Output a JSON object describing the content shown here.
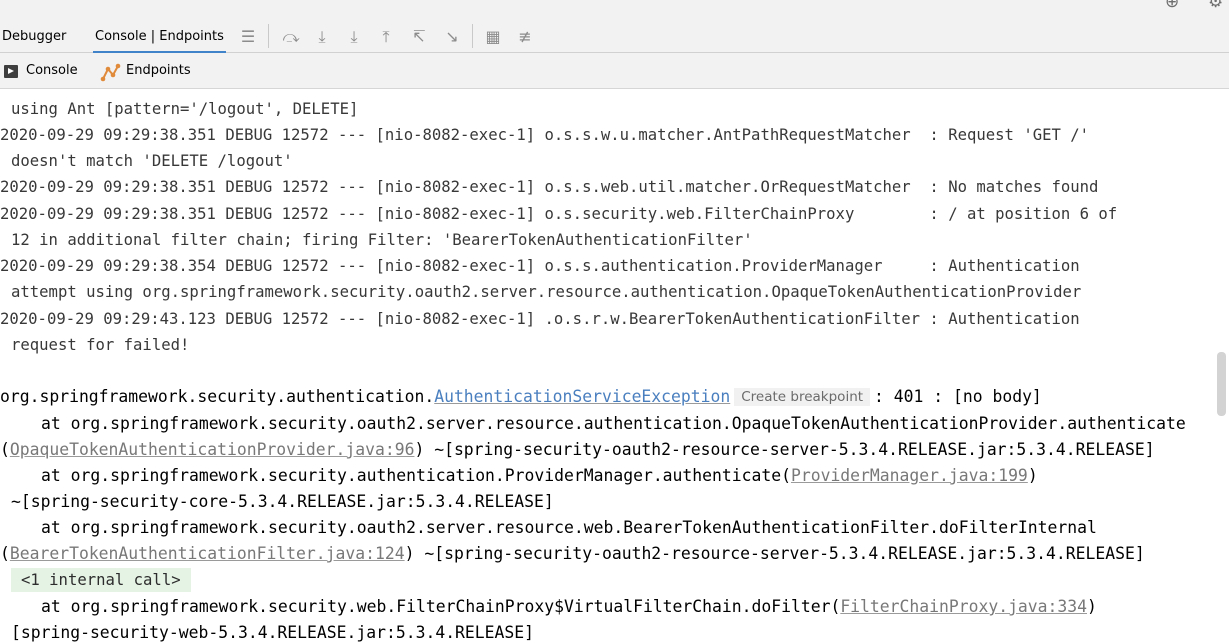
{
  "toolbar": {
    "tabs": [
      {
        "label": "Debugger",
        "active": false
      },
      {
        "label": "Console | Endpoints",
        "active": true
      }
    ],
    "icons": [
      "menu-icon",
      "show-execution-point-icon",
      "step-over-icon",
      "step-into-icon",
      "step-out-icon",
      "run-to-cursor-icon",
      "evaluate-expression-icon",
      "table-view-icon",
      "trace-settings-icon"
    ]
  },
  "subtabs": [
    {
      "label": "Console",
      "icon": "console-icon"
    },
    {
      "label": "Endpoints",
      "icon": "endpoints-icon"
    }
  ],
  "console": {
    "lines": [
      {
        "text": "using Ant [pattern='/logout', DELETE]",
        "indent": true
      },
      {
        "text": "2020-09-29 09:29:38.351 DEBUG 12572 --- [nio-8082-exec-1] o.s.s.w.u.matcher.AntPathRequestMatcher  : Request 'GET /'"
      },
      {
        "text": "doesn't match 'DELETE /logout'",
        "indent": true
      },
      {
        "text": "2020-09-29 09:29:38.351 DEBUG 12572 --- [nio-8082-exec-1] o.s.s.web.util.matcher.OrRequestMatcher  : No matches found"
      },
      {
        "text": "2020-09-29 09:29:38.351 DEBUG 12572 --- [nio-8082-exec-1] o.s.security.web.FilterChainProxy        : / at position 6 of"
      },
      {
        "text": "12 in additional filter chain; firing Filter: 'BearerTokenAuthenticationFilter'",
        "indent": true
      },
      {
        "text": "2020-09-29 09:29:38.354 DEBUG 12572 --- [nio-8082-exec-1] o.s.s.authentication.ProviderManager     : Authentication"
      },
      {
        "text": "attempt using org.springframework.security.oauth2.server.resource.authentication.OpaqueTokenAuthenticationProvider",
        "indent": true
      },
      {
        "text": "2020-09-29 09:29:43.123 DEBUG 12572 --- [nio-8082-exec-1] .o.s.r.w.BearerTokenAuthenticationFilter : Authentication"
      },
      {
        "text": "request for failed!",
        "indent": true
      }
    ],
    "exception": {
      "prefix": "org.springframework.security.authentication.",
      "class_name": "AuthenticationServiceException",
      "breakpoint_label": "Create breakpoint",
      "message": ": 401 : [no body]"
    },
    "trace1": {
      "at": "at org.springframework.security.oauth2.server.resource.authentication.OpaqueTokenAuthenticationProvider.authenticate",
      "open": "(",
      "link": "OpaqueTokenAuthenticationProvider.java:96",
      "tail": ") ~[spring-security-oauth2-resource-server-5.3.4.RELEASE.jar:5.3.4.RELEASE]"
    },
    "trace2": {
      "at": "at org.springframework.security.authentication.ProviderManager.authenticate(",
      "link": "ProviderManager.java:199",
      "close": ")",
      "jar": "~[spring-security-core-5.3.4.RELEASE.jar:5.3.4.RELEASE]"
    },
    "trace3": {
      "at": "at org.springframework.security.oauth2.server.resource.web.BearerTokenAuthenticationFilter.doFilterInternal",
      "open": "(",
      "link": "BearerTokenAuthenticationFilter.java:124",
      "tail": ") ~[spring-security-oauth2-resource-server-5.3.4.RELEASE.jar:5.3.4.RELEASE]"
    },
    "internal_call": "<1 internal call>",
    "trace4": {
      "at": "at org.springframework.security.web.FilterChainProxy$VirtualFilterChain.doFilter(",
      "link": "FilterChainProxy.java:334",
      "close": ")",
      "jar": "[spring-security-web-5.3.4.RELEASE.jar:5.3.4.RELEASE]"
    }
  },
  "colors": {
    "link": "#787878",
    "exception_class": "#4a7fbf",
    "active_tab_underline": "#4083c9",
    "internal_call_bg": "#e5f3e5"
  }
}
